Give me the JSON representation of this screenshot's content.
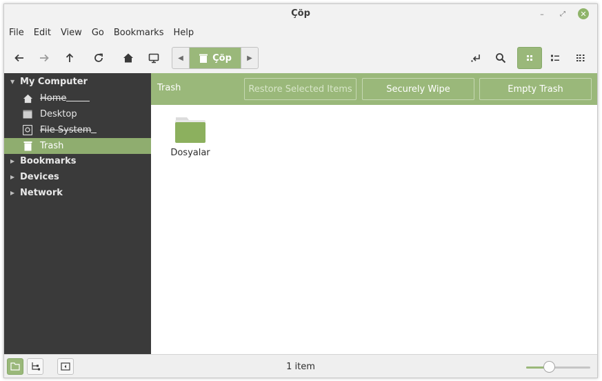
{
  "window": {
    "title": "Çöp"
  },
  "menu": [
    "File",
    "Edit",
    "View",
    "Go",
    "Bookmarks",
    "Help"
  ],
  "pathbar": {
    "crumb": "Çöp"
  },
  "sidebar": {
    "sections": [
      {
        "label": "My Computer",
        "expanded": true
      },
      {
        "label": "Bookmarks",
        "expanded": false
      },
      {
        "label": "Devices",
        "expanded": false
      },
      {
        "label": "Network",
        "expanded": false
      }
    ],
    "items": [
      {
        "label": "Home",
        "icon": "home-icon"
      },
      {
        "label": "Desktop",
        "icon": "desktop-icon"
      },
      {
        "label": "File System",
        "icon": "file-system-icon"
      },
      {
        "label": "Trash",
        "icon": "trash-icon",
        "selected": true
      }
    ]
  },
  "trashbar": {
    "label": "Trash",
    "restore": "Restore Selected Items",
    "wipe": "Securely Wipe",
    "empty": "Empty Trash"
  },
  "files": [
    {
      "name": "Dosyalar",
      "icon": "folder-icon"
    }
  ],
  "status": {
    "text": "1 item",
    "zoom_level": 0.35
  },
  "colors": {
    "accent": "#9ab87a",
    "sidebar_bg": "#3a3a3a",
    "folder": "#8cb05e"
  }
}
